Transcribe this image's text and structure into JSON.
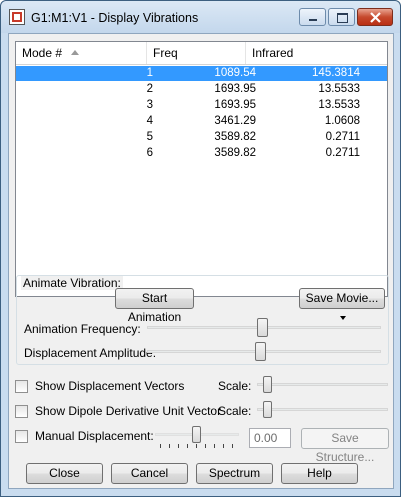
{
  "window": {
    "title": "G1:M1:V1 - Display Vibrations"
  },
  "list": {
    "columns": [
      "Mode #",
      "Freq",
      "Infrared"
    ],
    "rows": [
      {
        "mode": "1",
        "freq": "1089.54",
        "ir": "145.3814"
      },
      {
        "mode": "2",
        "freq": "1693.95",
        "ir": "13.5533"
      },
      {
        "mode": "3",
        "freq": "1693.95",
        "ir": "13.5533"
      },
      {
        "mode": "4",
        "freq": "3461.29",
        "ir": "1.0608"
      },
      {
        "mode": "5",
        "freq": "3589.82",
        "ir": "0.2711"
      },
      {
        "mode": "6",
        "freq": "3589.82",
        "ir": "0.2711"
      }
    ],
    "selected_row": 1
  },
  "animate": {
    "group_label": "Animate Vibration:",
    "start_button": "Start Animation",
    "save_movie_button": "Save Movie...",
    "frequency_label": "Animation Frequency:",
    "amplitude_label": "Displacement Amplitude:"
  },
  "options": {
    "show_vectors_label": "Show Displacement Vectors",
    "show_dipole_label": "Show Dipole Derivative Unit Vector",
    "manual_label": "Manual Displacement:",
    "scale_label": "Scale:",
    "manual_value": "0.00",
    "save_structure_button": "Save Structure..."
  },
  "buttons": {
    "close": "Close",
    "cancel": "Cancel",
    "spectrum": "Spectrum",
    "help": "Help"
  },
  "colors": {
    "selection": "#3399ff",
    "close_button": "#c6492d",
    "frame": "#c9dcef"
  }
}
